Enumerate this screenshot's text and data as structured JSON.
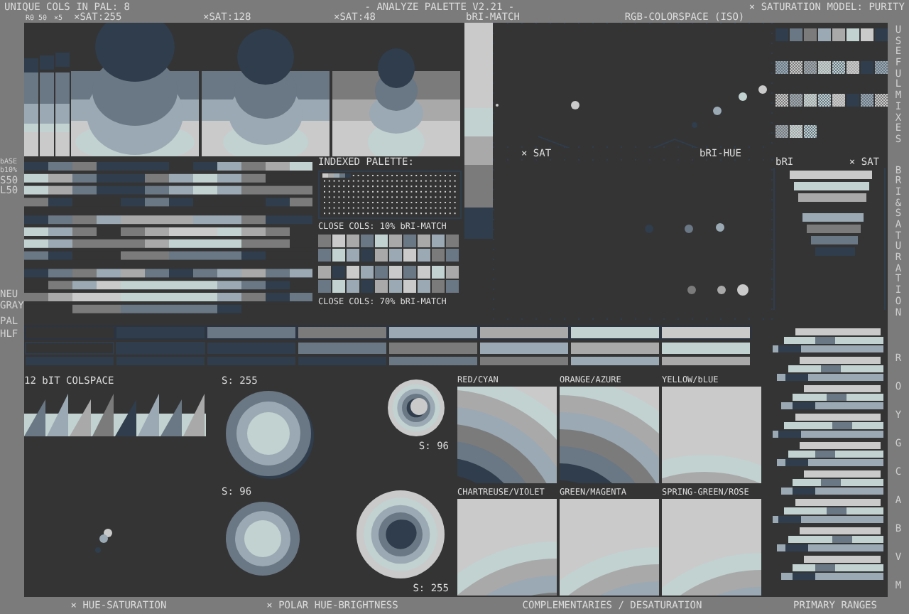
{
  "header": {
    "unique_count": "UNIQUE COLS IN PAL: 8",
    "title": "- ANALYZE PALETTE V2.21 -",
    "saturation_model": "× SATURATION MODEL: PURITY"
  },
  "column_labels": [
    "R0",
    "50",
    "×5",
    "×SAT:255",
    "×SAT:128",
    "×SAT:48",
    "bRI-MATCH",
    "RGB-COLORSPACE (ISO)"
  ],
  "palette": [
    {
      "color": "#343434"
    },
    {
      "color": "#2f3d4c"
    },
    {
      "color": "#6a7784"
    },
    {
      "color": "#7b7b7b"
    },
    {
      "color": "#9aa9b3"
    },
    {
      "color": "#a9a9a9"
    },
    {
      "color": "#c1d2d0"
    },
    {
      "color": "#cacaca"
    }
  ],
  "row_labels": [
    "bASE",
    "b10%",
    "S50",
    "L50",
    "NEU GRAY",
    "PAL",
    "HLF"
  ],
  "indexed_palette": {
    "title": "INDEXED PALETTE:",
    "close_cols": [
      "CLOSE COLS: 10% bRI-MATCH",
      "CLOSE COLS: 70% bRI-MATCH"
    ]
  },
  "colorspace": {
    "labels": [
      "× SAT",
      "bRI-HUE"
    ]
  },
  "bri_saturation": {
    "labels": [
      "bRI",
      "× SAT"
    ]
  },
  "twelve_bit": "12 bIT COLSPACE",
  "polar": [
    {
      "label": "S: 255"
    },
    {
      "label": "S: 96"
    },
    {
      "label": "S: 96"
    },
    {
      "label": "S: 255"
    }
  ],
  "complementaries": [
    "RED/CYAN",
    "ORANGE/AZURE",
    "YELLOW/bLUE",
    "CHARTREUSE/VIOLET",
    "GREEN/MAGENTA",
    "SPRING-GREEN/ROSE"
  ],
  "side_titles": [
    "USEFUL MIXES",
    "BRI & SATURATION"
  ],
  "primary_ranges": [
    "R",
    "O",
    "Y",
    "G",
    "C",
    "A",
    "B",
    "V",
    "M"
  ],
  "footer": [
    "× HUE-SATURATION",
    "× POLAR HUE-BRIGHTNESS",
    "COMPLEMENTARIES / DESATURATION",
    "PRIMARY RANGES"
  ]
}
